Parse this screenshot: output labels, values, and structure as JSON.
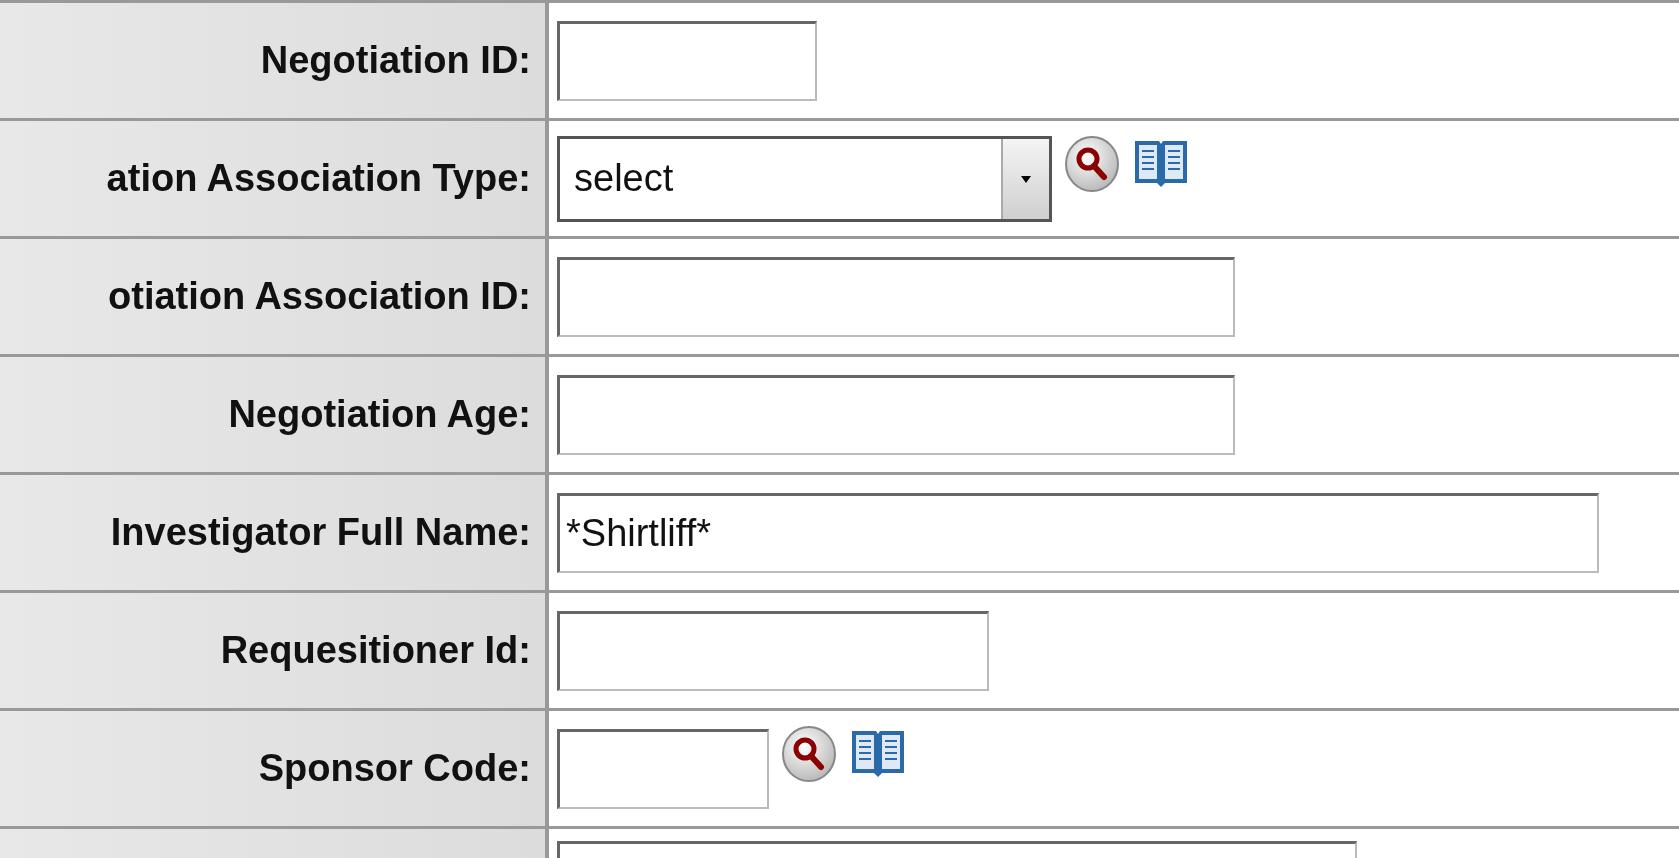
{
  "rows": [
    {
      "label": "Negotiation ID:",
      "kind": "text",
      "value": ""
    },
    {
      "label": "ation Association Type:",
      "kind": "select",
      "value": "select",
      "lookup": true
    },
    {
      "label": "otiation Association ID:",
      "kind": "text",
      "value": ""
    },
    {
      "label": "Negotiation Age:",
      "kind": "text",
      "value": ""
    },
    {
      "label": "Investigator Full Name:",
      "kind": "text",
      "value": "*Shirtliff*"
    },
    {
      "label": "Requesitioner Id:",
      "kind": "text",
      "value": ""
    },
    {
      "label": "Sponsor Code:",
      "kind": "text",
      "value": "",
      "lookup": true
    },
    {
      "kind": "text",
      "value": ""
    }
  ]
}
